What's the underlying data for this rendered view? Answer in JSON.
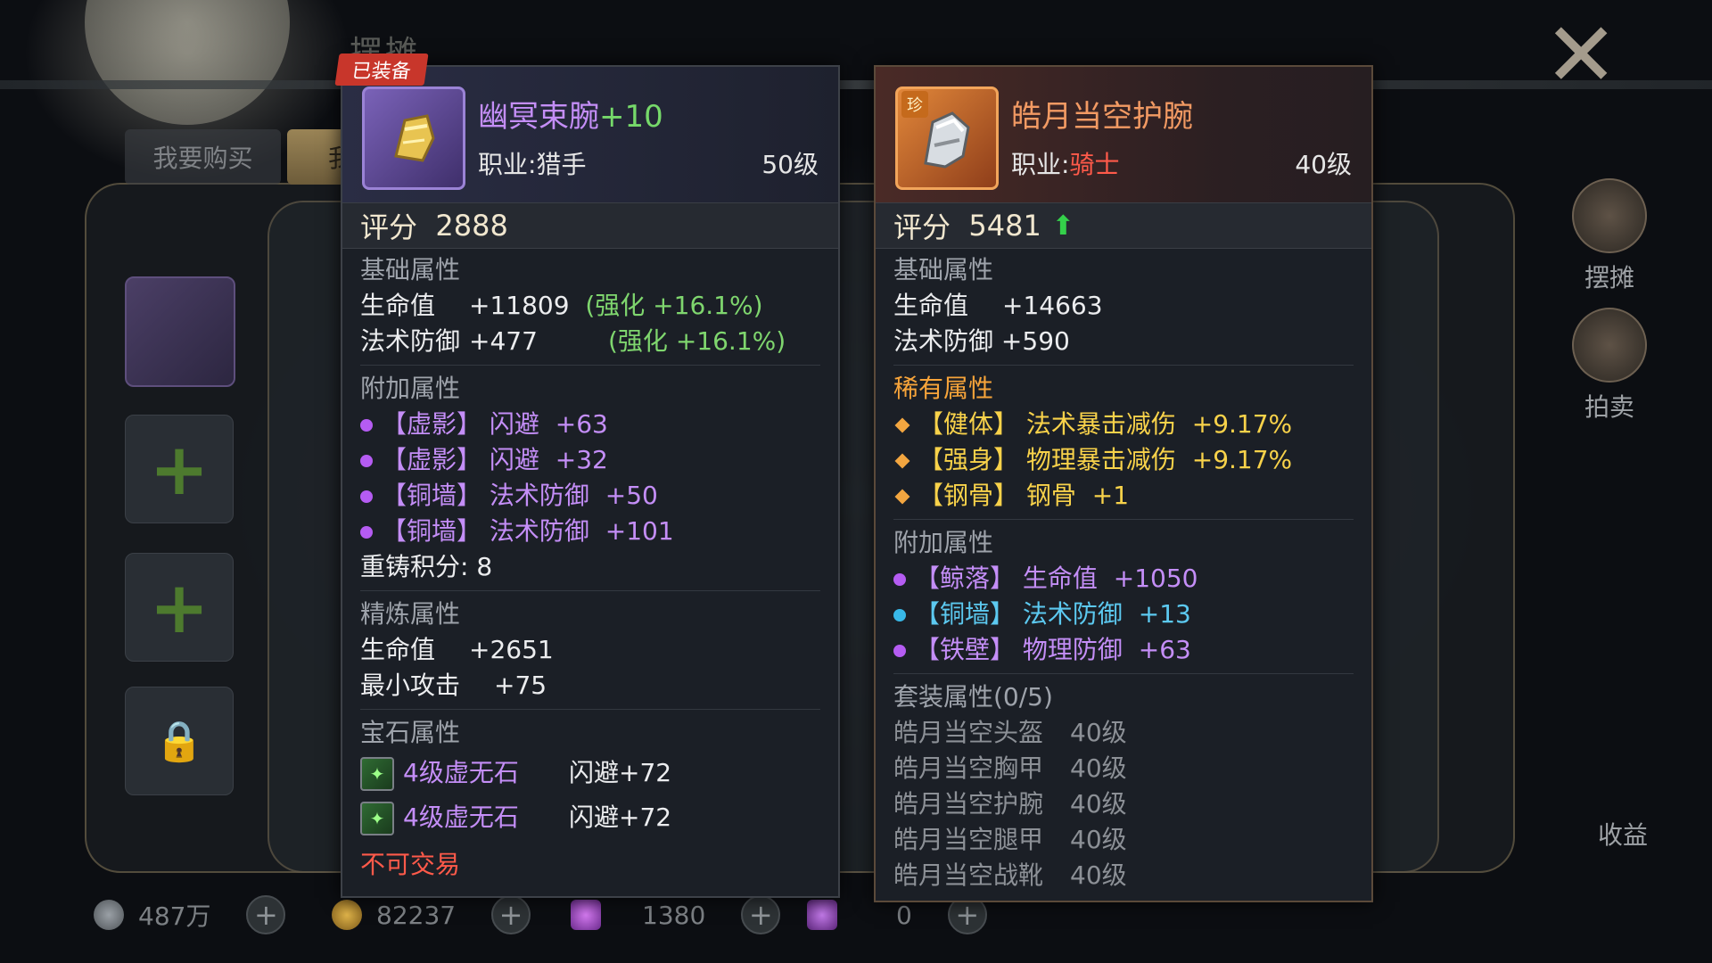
{
  "background": {
    "stall_title": "摆摊",
    "tabs": [
      "我要购买",
      "我"
    ],
    "side_buttons": [
      "摆摊",
      "拍卖"
    ],
    "side_income": "收益",
    "currencies": [
      {
        "icon": "silver-coin-icon",
        "value": "487万"
      },
      {
        "icon": "gold-coin-icon",
        "value": "82237"
      },
      {
        "icon": "purple-gem-icon",
        "value": "1380"
      },
      {
        "icon": "purple-crystal-icon",
        "value": "0"
      }
    ]
  },
  "left": {
    "badge": "已装备",
    "icon": "bracer-icon",
    "name": "幽冥束腕",
    "plus": "+10",
    "class_label": "职业:",
    "class_value": "猎手",
    "level": "50级",
    "score_label": "评分",
    "score": "2888",
    "base_title": "基础属性",
    "base": [
      {
        "k": "生命值",
        "v": "+11809",
        "bonus": "(强化  +16.1%)"
      },
      {
        "k": "法术防御",
        "v": "+477",
        "bonus": "(强化  +16.1%)"
      }
    ],
    "extra_title": "附加属性",
    "extra": [
      {
        "tag": "【虚影】",
        "k": "闪避",
        "v": "+63"
      },
      {
        "tag": "【虚影】",
        "k": "闪避",
        "v": "+32"
      },
      {
        "tag": "【铜墙】",
        "k": "法术防御",
        "v": "+50"
      },
      {
        "tag": "【铜墙】",
        "k": "法术防御",
        "v": "+101"
      }
    ],
    "reforge": "重铸积分: 8",
    "refine_title": "精炼属性",
    "refine": [
      {
        "k": "生命值",
        "v": "+2651"
      },
      {
        "k": "最小攻击",
        "v": "+75"
      }
    ],
    "gem_title": "宝石属性",
    "gems": [
      {
        "name": "4级虚无石",
        "effect": "闪避+72"
      },
      {
        "name": "4级虚无石",
        "effect": "闪避+72"
      }
    ],
    "trade": "不可交易"
  },
  "right": {
    "icon": "gauntlet-icon",
    "treasure": "珍",
    "name": "皓月当空护腕",
    "class_label": "职业:",
    "class_value": "骑士",
    "level": "40级",
    "score_label": "评分",
    "score": "5481",
    "base_title": "基础属性",
    "base": [
      {
        "k": "生命值",
        "v": "+14663"
      },
      {
        "k": "法术防御",
        "v": "+590"
      }
    ],
    "rare_title": "稀有属性",
    "rare": [
      {
        "tag": "【健体】",
        "k": "法术暴击减伤",
        "v": "+9.17%"
      },
      {
        "tag": "【强身】",
        "k": "物理暴击减伤",
        "v": "+9.17%"
      },
      {
        "tag": "【钢骨】",
        "k": "钢骨",
        "v": "+1"
      }
    ],
    "extra_title": "附加属性",
    "extra": [
      {
        "tag": "【鲸落】",
        "k": "生命值",
        "v": "+1050",
        "color": "purple"
      },
      {
        "tag": "【铜墙】",
        "k": "法术防御",
        "v": "+13",
        "color": "cyan"
      },
      {
        "tag": "【铁壁】",
        "k": "物理防御",
        "v": "+63",
        "color": "purple"
      }
    ],
    "set_title": "套装属性(0/5)",
    "set": [
      {
        "name": "皓月当空头盔",
        "level": "40级"
      },
      {
        "name": "皓月当空胸甲",
        "level": "40级"
      },
      {
        "name": "皓月当空护腕",
        "level": "40级"
      },
      {
        "name": "皓月当空腿甲",
        "level": "40级"
      },
      {
        "name": "皓月当空战靴",
        "level": "40级"
      }
    ]
  },
  "colors": {
    "accent_green": "#7fd66e",
    "rare_orange": "#f7a43a",
    "purple_attr": "#c48ef7",
    "cyan_attr": "#5cc9f0",
    "warning_red": "#ff5a4a"
  }
}
